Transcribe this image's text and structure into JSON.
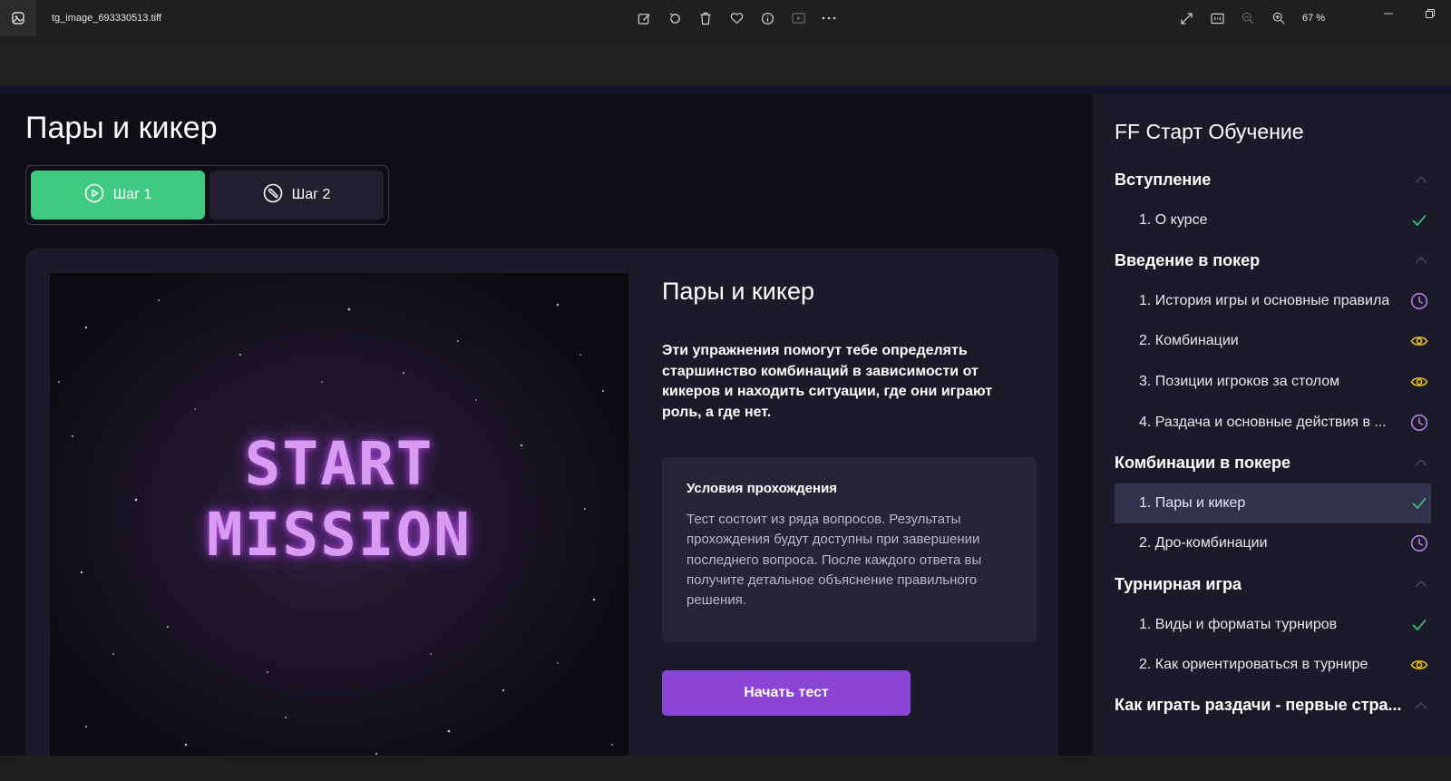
{
  "viewer": {
    "filename": "tg_image_693330513.tiff",
    "zoom": "67 %",
    "toolbar_icons": [
      "edit-icon",
      "rotate-icon",
      "delete-icon",
      "favorite-icon",
      "info-icon",
      "slideshow-icon",
      "more-icon"
    ],
    "zoom_icons": [
      "fullscreen-icon",
      "fit-icon",
      "zoom-out-icon",
      "zoom-in-icon"
    ]
  },
  "page": {
    "title": "Пары и кикер",
    "tabs": [
      {
        "label": "Шаг 1",
        "icon": "play-circle-icon",
        "active": true
      },
      {
        "label": "Шаг 2",
        "icon": "pointer-icon",
        "active": false
      }
    ]
  },
  "lesson": {
    "hero_line1": "START",
    "hero_line2": "MISSION",
    "title": "Пары и кикер",
    "description": "Эти упражнения помогут тебе определять старшинство комбинаций в зависимости от кикеров и находить ситуации, где они играют роль, а где нет.",
    "conditions_title": "Условия прохождения",
    "conditions_text": "Тест состоит из ряда вопросов. Результаты прохождения будут доступны при завершении последнего вопроса. После каждого ответа вы получите детальное объяснение правильного решения.",
    "start_button": "Начать тест"
  },
  "sidebar": {
    "title": "FF Старт Обучение",
    "sections": [
      {
        "title": "Вступление",
        "items": [
          {
            "label": "1. О курсе",
            "status": "done"
          }
        ]
      },
      {
        "title": "Введение в покер",
        "items": [
          {
            "label": "1. История игры и основные правила",
            "status": "pending"
          },
          {
            "label": "2. Комбинации",
            "status": "viewed"
          },
          {
            "label": "3. Позиции игроков за столом",
            "status": "viewed"
          },
          {
            "label": "4. Раздача и основные действия в ...",
            "status": "pending"
          }
        ]
      },
      {
        "title": "Комбинации в покере",
        "items": [
          {
            "label": "1. Пары и кикер",
            "status": "done",
            "active": true
          },
          {
            "label": "2. Дро-комбинации",
            "status": "pending"
          }
        ]
      },
      {
        "title": "Турнирная игра",
        "items": [
          {
            "label": "1. Виды и форматы турниров",
            "status": "done"
          },
          {
            "label": "2. Как ориентироваться в турнире",
            "status": "viewed"
          }
        ]
      },
      {
        "title": "Как играть раздачи - первые стра...",
        "items": []
      }
    ],
    "status_colors": {
      "done": "#3fcb7f",
      "pending": "#b47ee8",
      "viewed": "#e8c21a"
    }
  }
}
